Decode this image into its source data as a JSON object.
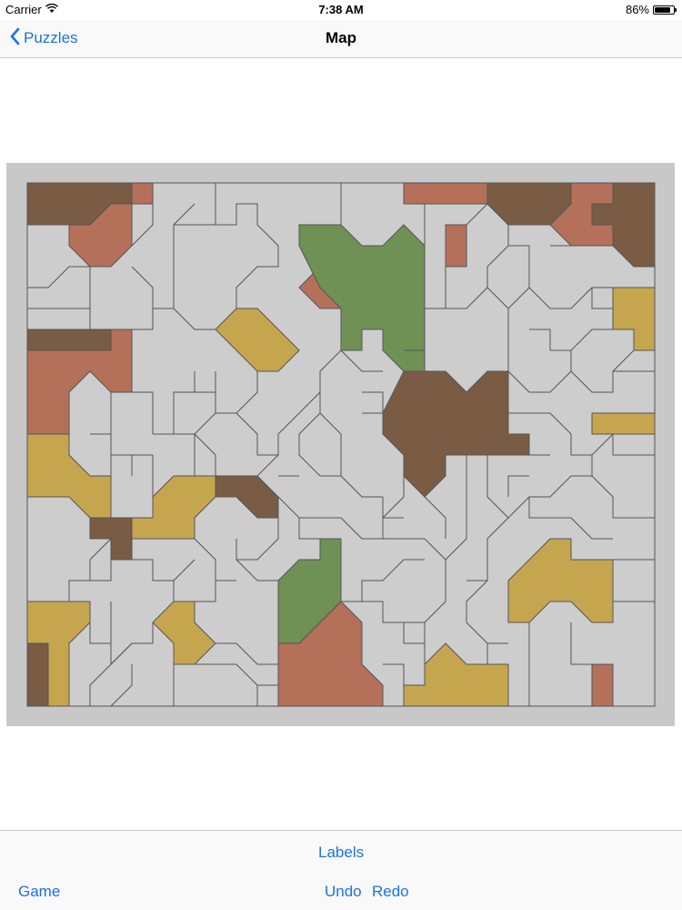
{
  "status": {
    "carrier": "Carrier",
    "time": "7:38 AM",
    "battery": "86%",
    "battery_level": 0.86
  },
  "nav": {
    "back_label": "Puzzles",
    "title": "Map"
  },
  "toolbar": {
    "labels": "Labels",
    "game": "Game",
    "undo": "Undo",
    "redo": "Redo"
  },
  "colors": {
    "grey": "#cdcdcd",
    "brown": "#7a5c44",
    "rust": "#b5705a",
    "olive": "#c5a64f",
    "green": "#6f9155",
    "accent": "#1a73e8"
  }
}
